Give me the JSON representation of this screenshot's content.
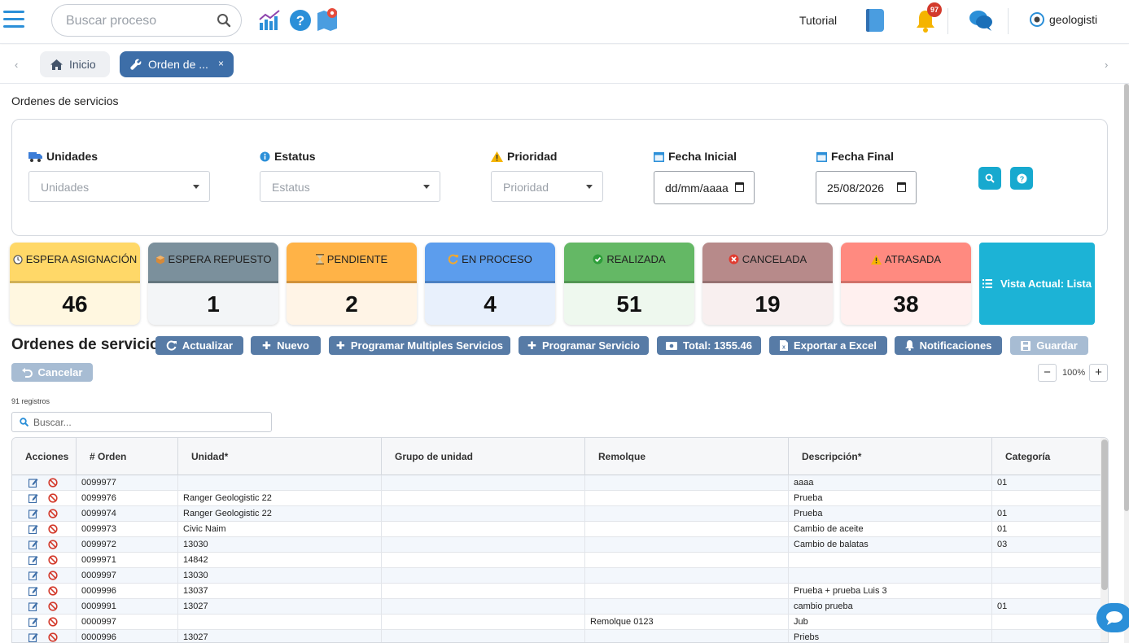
{
  "header": {
    "search_placeholder": "Buscar proceso",
    "tutorial": "Tutorial",
    "notifications_count": "97",
    "username": "geologisti"
  },
  "tabs": {
    "home": "Inicio",
    "active": "Orden de ...",
    "close": "×"
  },
  "page_title": "Ordenes de servicios",
  "filters": {
    "unidades_label": "Unidades",
    "unidades_placeholder": "Unidades",
    "estatus_label": "Estatus",
    "estatus_placeholder": "Estatus",
    "prioridad_label": "Prioridad",
    "prioridad_placeholder": "Prioridad",
    "fecha_inicial_label": "Fecha Inicial",
    "fecha_inicial_value": "dd/mm/aaaa",
    "fecha_final_label": "Fecha Final",
    "fecha_final_value": "25/08/2026"
  },
  "status_cards": [
    {
      "label": "ESPERA ASIGNACIÓN",
      "count": "46",
      "head_color": "#ffd868",
      "body_color": "#fff7e0",
      "icon": "clock-icon"
    },
    {
      "label": "ESPERA REPUESTO",
      "count": "1",
      "head_color": "#7b909c",
      "body_color": "#f3f5f7",
      "icon": "box-icon"
    },
    {
      "label": "PENDIENTE",
      "count": "2",
      "head_color": "#ffb347",
      "body_color": "#fff4e6",
      "icon": "hourglass-icon"
    },
    {
      "label": "EN PROCESO",
      "count": "4",
      "head_color": "#5c9ded",
      "body_color": "#e8f0fc",
      "icon": "refresh-icon"
    },
    {
      "label": "REALIZADA",
      "count": "51",
      "head_color": "#64b865",
      "body_color": "#eef8ee",
      "icon": "check-icon"
    },
    {
      "label": "CANCELADA",
      "count": "19",
      "head_color": "#b78a8a",
      "body_color": "#f8efef",
      "icon": "cancel-icon"
    },
    {
      "label": "ATRASADA",
      "count": "38",
      "head_color": "#ff8a80",
      "body_color": "#fff0ef",
      "icon": "warning-icon"
    }
  ],
  "vista_actual": "Vista Actual: Lista",
  "toolbar": {
    "title": "Ordenes de servicios",
    "actualizar": "Actualizar",
    "nuevo": "Nuevo",
    "programar_multiples": "Programar Multiples Servicios",
    "programar_servicio": "Programar Servicio",
    "total": "Total: 1355.46",
    "exportar": "Exportar a Excel",
    "notificaciones": "Notificaciones",
    "guardar": "Guardar",
    "cancelar": "Cancelar",
    "zoom": "100%",
    "zoom_minus": "−",
    "zoom_plus": "+"
  },
  "grid": {
    "record_count": "91 registros",
    "search_placeholder": "Buscar...",
    "columns": [
      "Acciones",
      "# Orden",
      "Unidad*",
      "Grupo de unidad",
      "Remolque",
      "Descripción*",
      "Categoría"
    ],
    "rows": [
      {
        "orden": "0099977",
        "unidad": "",
        "grupo": "",
        "remolque": "",
        "descripcion": "aaaa",
        "categoria": "01"
      },
      {
        "orden": "0099976",
        "unidad": "Ranger Geologistic 22",
        "grupo": "",
        "remolque": "",
        "descripcion": "Prueba",
        "categoria": ""
      },
      {
        "orden": "0099974",
        "unidad": "Ranger Geologistic 22",
        "grupo": "",
        "remolque": "",
        "descripcion": "Prueba",
        "categoria": "01"
      },
      {
        "orden": "0099973",
        "unidad": "Civic Naim",
        "grupo": "",
        "remolque": "",
        "descripcion": "Cambio de aceite",
        "categoria": "01"
      },
      {
        "orden": "0099972",
        "unidad": "13030",
        "grupo": "",
        "remolque": "",
        "descripcion": "Cambio de balatas",
        "categoria": "03"
      },
      {
        "orden": "0099971",
        "unidad": "14842",
        "grupo": "",
        "remolque": "",
        "descripcion": "",
        "categoria": ""
      },
      {
        "orden": "0009997",
        "unidad": "13030",
        "grupo": "",
        "remolque": "",
        "descripcion": "",
        "categoria": ""
      },
      {
        "orden": "0009996",
        "unidad": "13037",
        "grupo": "",
        "remolque": "",
        "descripcion": "Prueba + prueba Luis 3",
        "categoria": ""
      },
      {
        "orden": "0009991",
        "unidad": "13027",
        "grupo": "",
        "remolque": "",
        "descripcion": "cambio prueba",
        "categoria": "01"
      },
      {
        "orden": "0000997",
        "unidad": "",
        "grupo": "",
        "remolque": "Remolque 0123",
        "descripcion": "Jub",
        "categoria": ""
      },
      {
        "orden": "0000996",
        "unidad": "13027",
        "grupo": "",
        "remolque": "",
        "descripcion": "Priebs",
        "categoria": ""
      }
    ]
  }
}
